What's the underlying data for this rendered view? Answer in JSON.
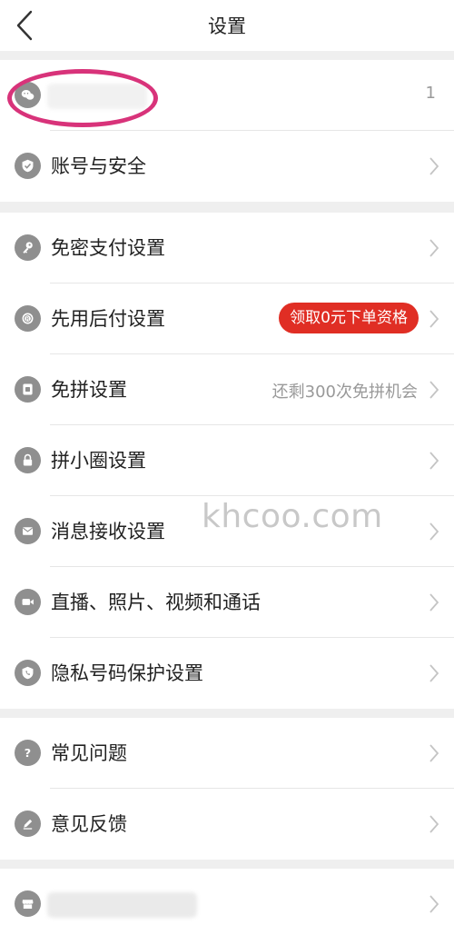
{
  "header": {
    "title": "设置",
    "back_icon": "chevron-left-icon"
  },
  "groups": [
    {
      "rows": [
        {
          "label": "",
          "icon": "wechat-icon",
          "trail_count": "1"
        },
        {
          "label": "账号与安全",
          "icon": "shield-check-icon"
        }
      ]
    },
    {
      "rows": [
        {
          "label": "免密支付设置",
          "icon": "key-icon"
        },
        {
          "label": "先用后付设置",
          "icon": "badge-icon",
          "badge": "领取0元下单资格"
        },
        {
          "label": "免拼设置",
          "icon": "card-icon",
          "value": "还剩300次免拼机会"
        },
        {
          "label": "拼小圈设置",
          "icon": "lock-icon"
        },
        {
          "label": "消息接收设置",
          "icon": "mail-icon"
        },
        {
          "label": "直播、照片、视频和通话",
          "icon": "video-camera-icon"
        },
        {
          "label": "隐私号码保护设置",
          "icon": "phone-shield-icon"
        }
      ]
    },
    {
      "rows": [
        {
          "label": "常见问题",
          "icon": "question-icon"
        },
        {
          "label": "意见反馈",
          "icon": "pencil-icon"
        }
      ]
    },
    {
      "rows": [
        {
          "label": "",
          "icon": "store-icon"
        }
      ]
    }
  ],
  "watermark": "khcoo.com",
  "colors": {
    "badge_bg": "#e02e24",
    "highlight_ring": "#d8337a",
    "icon_gray": "#8f8f8f"
  }
}
